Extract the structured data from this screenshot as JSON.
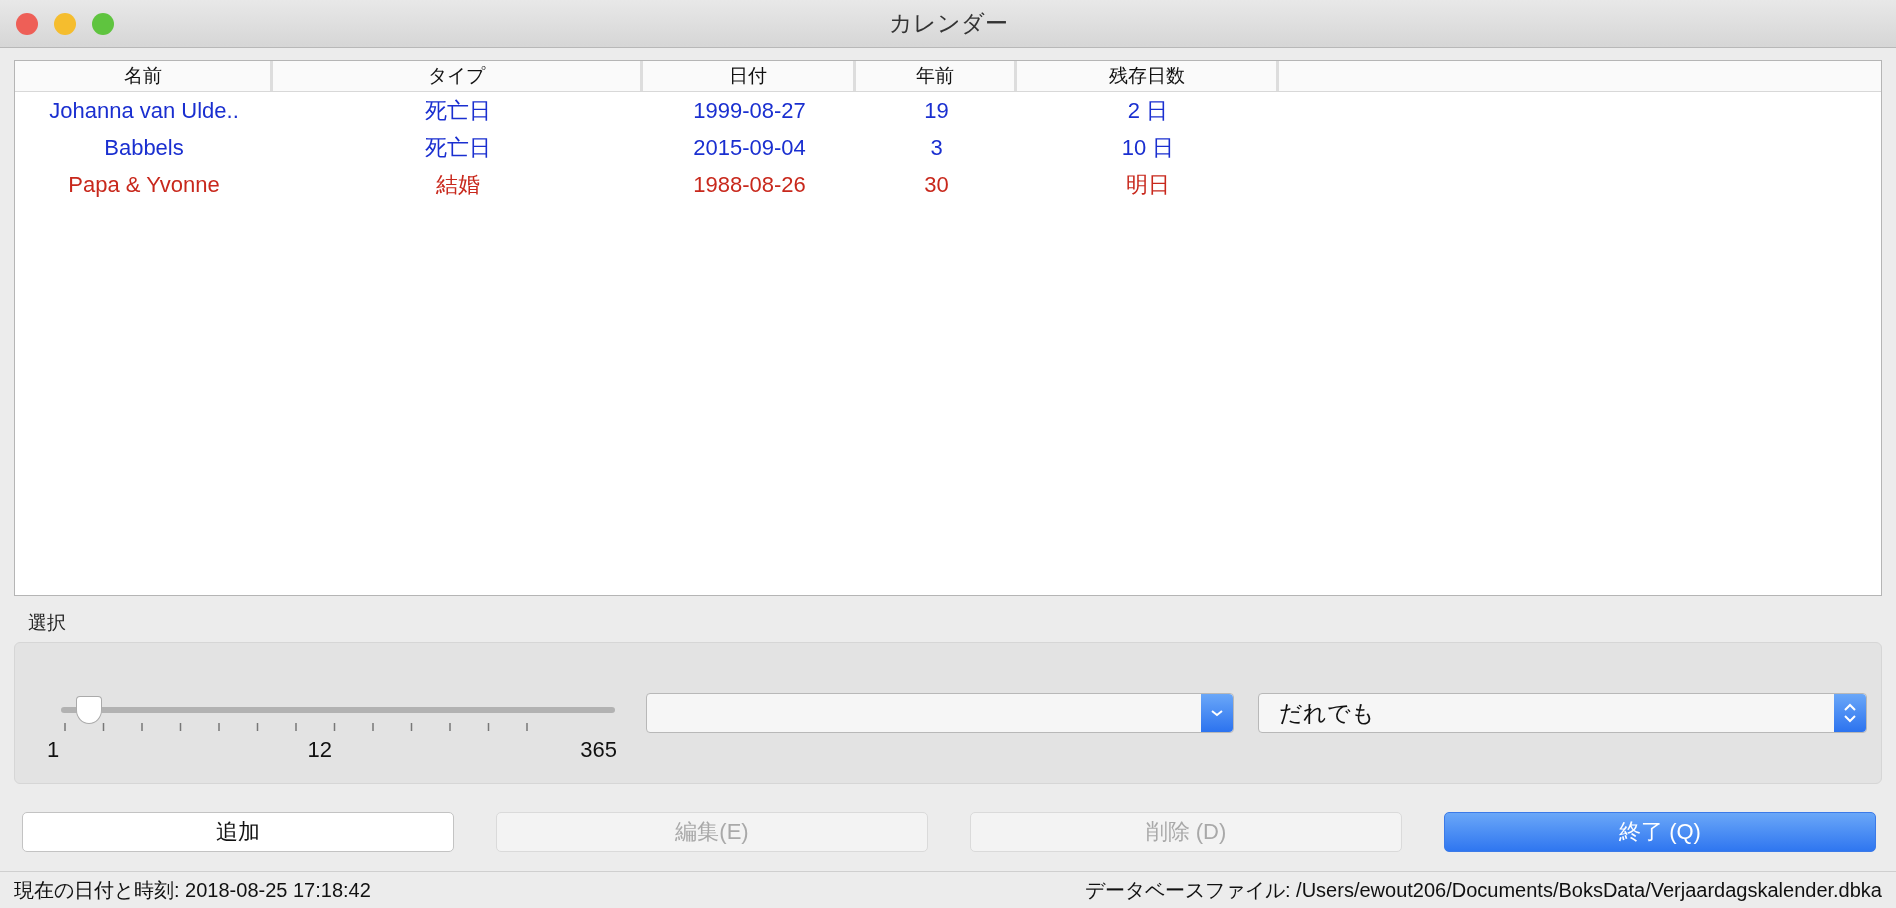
{
  "window": {
    "title": "カレンダー"
  },
  "table": {
    "columns": [
      "名前",
      "タイプ",
      "日付",
      "年前",
      "残存日数"
    ],
    "rows": [
      {
        "color": "#1a2fd0",
        "cells": [
          "Johanna van Ulde..",
          "死亡日",
          "1999-08-27",
          "19",
          "2 日"
        ]
      },
      {
        "color": "#1a2fd0",
        "cells": [
          "Babbels",
          "死亡日",
          "2015-09-04",
          "3",
          "10 日"
        ]
      },
      {
        "color": "#c8281c",
        "cells": [
          "Papa & Yvonne",
          "結婚",
          "1988-08-26",
          "30",
          "明日"
        ]
      }
    ]
  },
  "selection": {
    "label": "選択",
    "slider": {
      "level": 0.05,
      "labels": [
        "1",
        "12",
        "365"
      ]
    },
    "dropdown_2": {
      "value": "だれでも"
    }
  },
  "buttons": [
    {
      "label": "追加",
      "disabled": false,
      "default": false
    },
    {
      "label": "編集(E)",
      "disabled": true,
      "default": false
    },
    {
      "label": "削除 (D)",
      "disabled": true,
      "default": false
    },
    {
      "label": "終了 (Q)",
      "disabled": false,
      "default": true
    }
  ],
  "status_bar": {
    "left": "現在の日付と時刻: 2018-08-25 17:18:42",
    "right": "データベースファイル: /Users/ewout206/Documents/BoksData/Verjaardagskalender.dbka"
  }
}
